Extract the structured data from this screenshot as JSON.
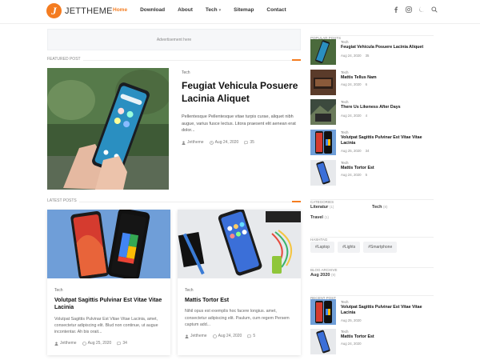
{
  "header": {
    "logo_letter": "J",
    "logo_text": "JETTHEME",
    "nav": [
      "Home",
      "Download",
      "About",
      "Tech",
      "Sitemap",
      "Contact"
    ]
  },
  "ad": {
    "text": "Advertisement here"
  },
  "featured": {
    "heading": "FEATURED POST",
    "category": "Tech",
    "title": "Feugiat Vehicula Posuere Lacinia Aliquet",
    "excerpt": "Pellentesque Pellentesque vitae turpis curae, aliquet nibh augue, varius fusce lectus. Litora praesent elit aenean erat dolor...",
    "author": "Jettheme",
    "date": "Aug 24, 2020",
    "comments": "35"
  },
  "latest": {
    "heading": "LATEST POSTS",
    "cards": [
      {
        "category": "Tech",
        "title": "Volutpat Sagittis Pulvinar Est Vitae Vitae Lacinia",
        "excerpt": "Volutpat Sagittis Pulvinar Est Vitae Vitae Lacinia, amet, consectetur adipiscing elit. Blud non continue, ut augue incontentar. Ah bis orait...",
        "author": "Jettheme",
        "date": "Aug 25, 2020",
        "comments": "34"
      },
      {
        "category": "Tech",
        "title": "Mattis Tortor Est",
        "excerpt": "Nihil opus est exemplis hoc facere longius. amet, consectetur adipiscing elit. Paulum, cum regem Persem captum add...",
        "author": "Jettheme",
        "date": "Aug 24, 2020",
        "comments": "5"
      }
    ]
  },
  "sidebar": {
    "popular_heading": "POPULAR POSTS",
    "popular": [
      {
        "category": "Tech",
        "title": "Feugiat Vehicula Posuere Lacinia Aliquet",
        "date": "Aug 24, 2020",
        "comments": "35"
      },
      {
        "category": "Tech",
        "title": "Mattis Tellus Nam",
        "date": "Aug 24, 2020",
        "comments": "6"
      },
      {
        "category": "Tech",
        "title": "There Us Likeness After Days",
        "date": "Aug 24, 2020",
        "comments": "4"
      },
      {
        "category": "Tech",
        "title": "Volutpat Sagittis Pulvinar Est Vitae Vitae Lacinia",
        "date": "Aug 25, 2020",
        "comments": "34"
      },
      {
        "category": "Tech",
        "title": "Mattis Tortor Est",
        "date": "Aug 24, 2020",
        "comments": "5"
      }
    ],
    "categories_heading": "CATEGORIES",
    "categories": [
      {
        "name": "Literatur",
        "count": "(1)"
      },
      {
        "name": "Tech",
        "count": "(8)"
      },
      {
        "name": "Travel",
        "count": "(1)"
      }
    ],
    "hashtag_heading": "HASHTAG",
    "tags": [
      "#Laptop",
      "#Lights",
      "#Smartphone"
    ],
    "archive_heading": "BLOG ARCHIVE",
    "archive_label": "Aug 2020",
    "archive_count": "(9)",
    "recent_heading": "RECENT POST",
    "recent": [
      {
        "category": "Tech",
        "title": "Volutpat Sagittis Pulvinar Est Vitae Vitae Lacinia",
        "date": "Aug 25, 2020"
      },
      {
        "category": "Tech",
        "title": "Mattis Tortor Est",
        "date": "Aug 24, 2020"
      }
    ]
  }
}
